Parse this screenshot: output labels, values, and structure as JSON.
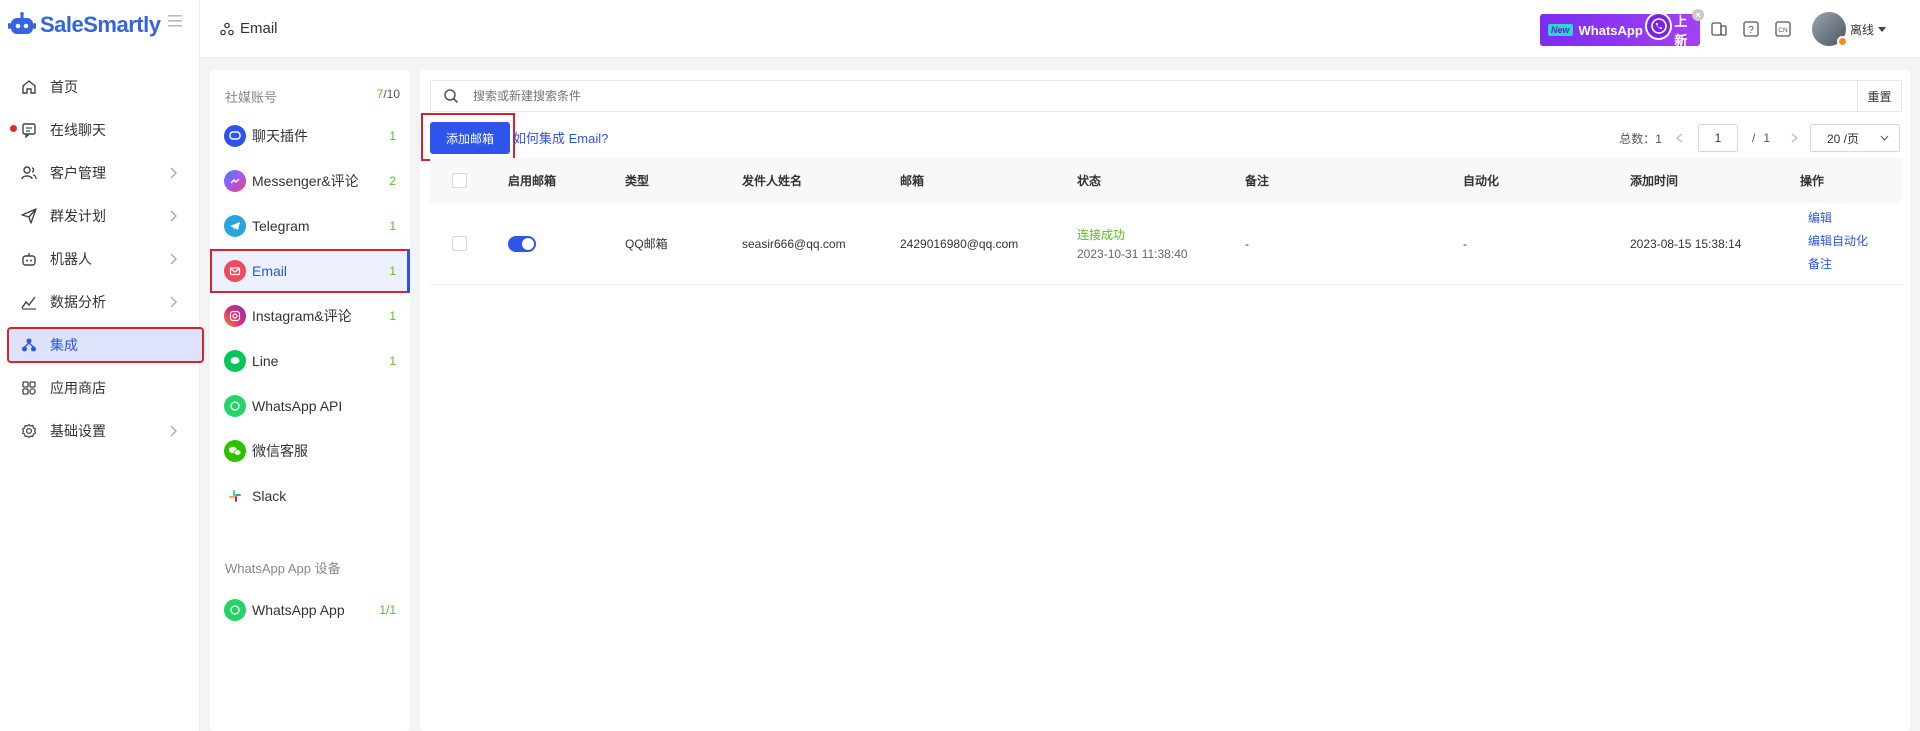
{
  "app": {
    "name": "SaleSmartly"
  },
  "nav": [
    {
      "label": "首页",
      "icon": "home-icon",
      "chevron": false
    },
    {
      "label": "在线聊天",
      "icon": "chat-icon",
      "chevron": false,
      "dot": true
    },
    {
      "label": "客户管理",
      "icon": "customers-icon",
      "chevron": true
    },
    {
      "label": "群发计划",
      "icon": "send-icon",
      "chevron": true
    },
    {
      "label": "机器人",
      "icon": "robot-icon",
      "chevron": true
    },
    {
      "label": "数据分析",
      "icon": "analytics-icon",
      "chevron": true
    },
    {
      "label": "集成",
      "icon": "integration-icon",
      "chevron": false,
      "active": true
    },
    {
      "label": "应用商店",
      "icon": "app-store-icon",
      "chevron": false
    },
    {
      "label": "基础设置",
      "icon": "settings-icon",
      "chevron": true
    }
  ],
  "topbar": {
    "breadcrumb": "Email",
    "banner": {
      "new": "New",
      "whatsapp": "WhatsApp",
      "suffix": "上新",
      "close": "×"
    },
    "user_status": "离线"
  },
  "channels": {
    "header": "社媒账号",
    "count_used": "7",
    "count_total": "/10",
    "items": [
      {
        "label": "聊天插件",
        "count": "1",
        "icon": "chat-plugin-icon",
        "color": "#2f54eb"
      },
      {
        "label": "Messenger&评论",
        "count": "2",
        "icon": "messenger-icon",
        "color": "#7b61ff"
      },
      {
        "label": "Telegram",
        "count": "1",
        "icon": "telegram-icon",
        "color": "#2aa3df"
      },
      {
        "label": "Email",
        "count": "1",
        "icon": "email-icon",
        "color": "#f04a5e",
        "active": true
      },
      {
        "label": "Instagram&评论",
        "count": "1",
        "icon": "instagram-icon",
        "color": "#d62976"
      },
      {
        "label": "Line",
        "count": "1",
        "icon": "line-icon",
        "color": "#06c755"
      },
      {
        "label": "WhatsApp API",
        "count": "",
        "icon": "whatsapp-api-icon",
        "color": "#25d366"
      },
      {
        "label": "微信客服",
        "count": "",
        "icon": "wechat-icon",
        "color": "#2dc100"
      },
      {
        "label": "Slack",
        "count": "",
        "icon": "slack-icon",
        "color": "#e01e5a"
      }
    ],
    "device_header": "WhatsApp App 设备",
    "device_item": {
      "label": "WhatsApp App",
      "count": "1/1",
      "icon": "whatsapp-app-icon",
      "color": "#25d366"
    }
  },
  "main": {
    "search_placeholder": "搜索或新建搜索条件",
    "reset": "重置",
    "add_button": "添加邮箱",
    "help_link": "如何集成 Email?",
    "pager": {
      "total_label": "总数：1",
      "page": "1",
      "of": "/",
      "pages": "1",
      "size": "20 /页"
    },
    "columns": [
      "启用邮箱",
      "类型",
      "发件人姓名",
      "邮箱",
      "状态",
      "备注",
      "自动化",
      "添加时间",
      "操作"
    ],
    "rows": [
      {
        "enabled": true,
        "type": "QQ邮箱",
        "sender": "seasir666@qq.com",
        "email": "2429016980@qq.com",
        "status": "连接成功",
        "status_time": "2023-10-31 11:38:40",
        "note": "-",
        "automation": "-",
        "added": "2023-08-15 15:38:14",
        "actions": [
          "编辑",
          "编辑自动化",
          "备注"
        ]
      }
    ]
  }
}
